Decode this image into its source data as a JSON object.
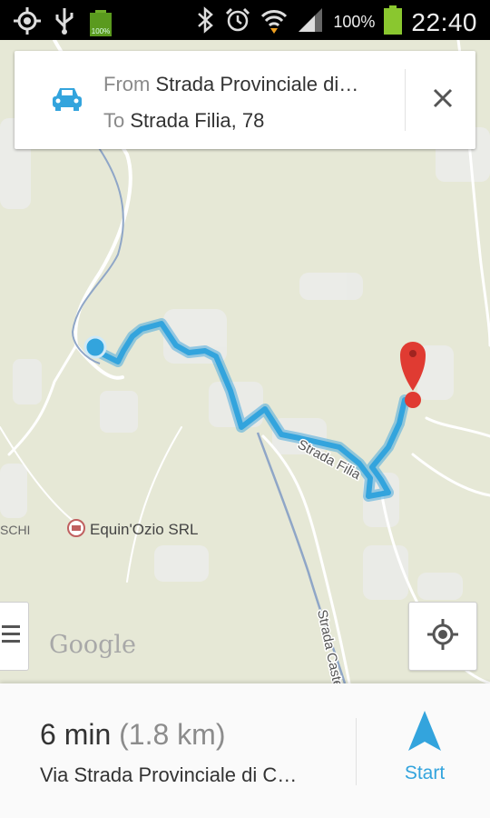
{
  "status_bar": {
    "battery_small": "100%",
    "battery_percent": "100%",
    "time": "22:40"
  },
  "directions_card": {
    "from_prefix": "From",
    "from_value": "Strada Provinciale di…",
    "to_prefix": "To",
    "to_value": "Strada Filia, 78"
  },
  "map": {
    "poi_label": "Equin'Ozio SRL",
    "partial_label": "SCHI",
    "road_label_1": "Strada Filia",
    "road_label_2": "Strada Castelnuo",
    "watermark": "Google"
  },
  "route_summary": {
    "time": "6 min",
    "distance": "(1.8 km)",
    "via": "Via Strada Provinciale di C…",
    "start_label": "Start"
  },
  "colors": {
    "route": "#33a4dd",
    "marker": "#e03b32",
    "start_button": "#33a4dd"
  },
  "icons": [
    "gps-icon",
    "usb-icon",
    "battery-icon",
    "bluetooth-icon",
    "alarm-icon",
    "wifi-icon",
    "signal-icon",
    "car-icon",
    "close-icon",
    "menu-icon",
    "my-location-icon",
    "navigate-arrow-icon",
    "destination-pin-icon"
  ]
}
